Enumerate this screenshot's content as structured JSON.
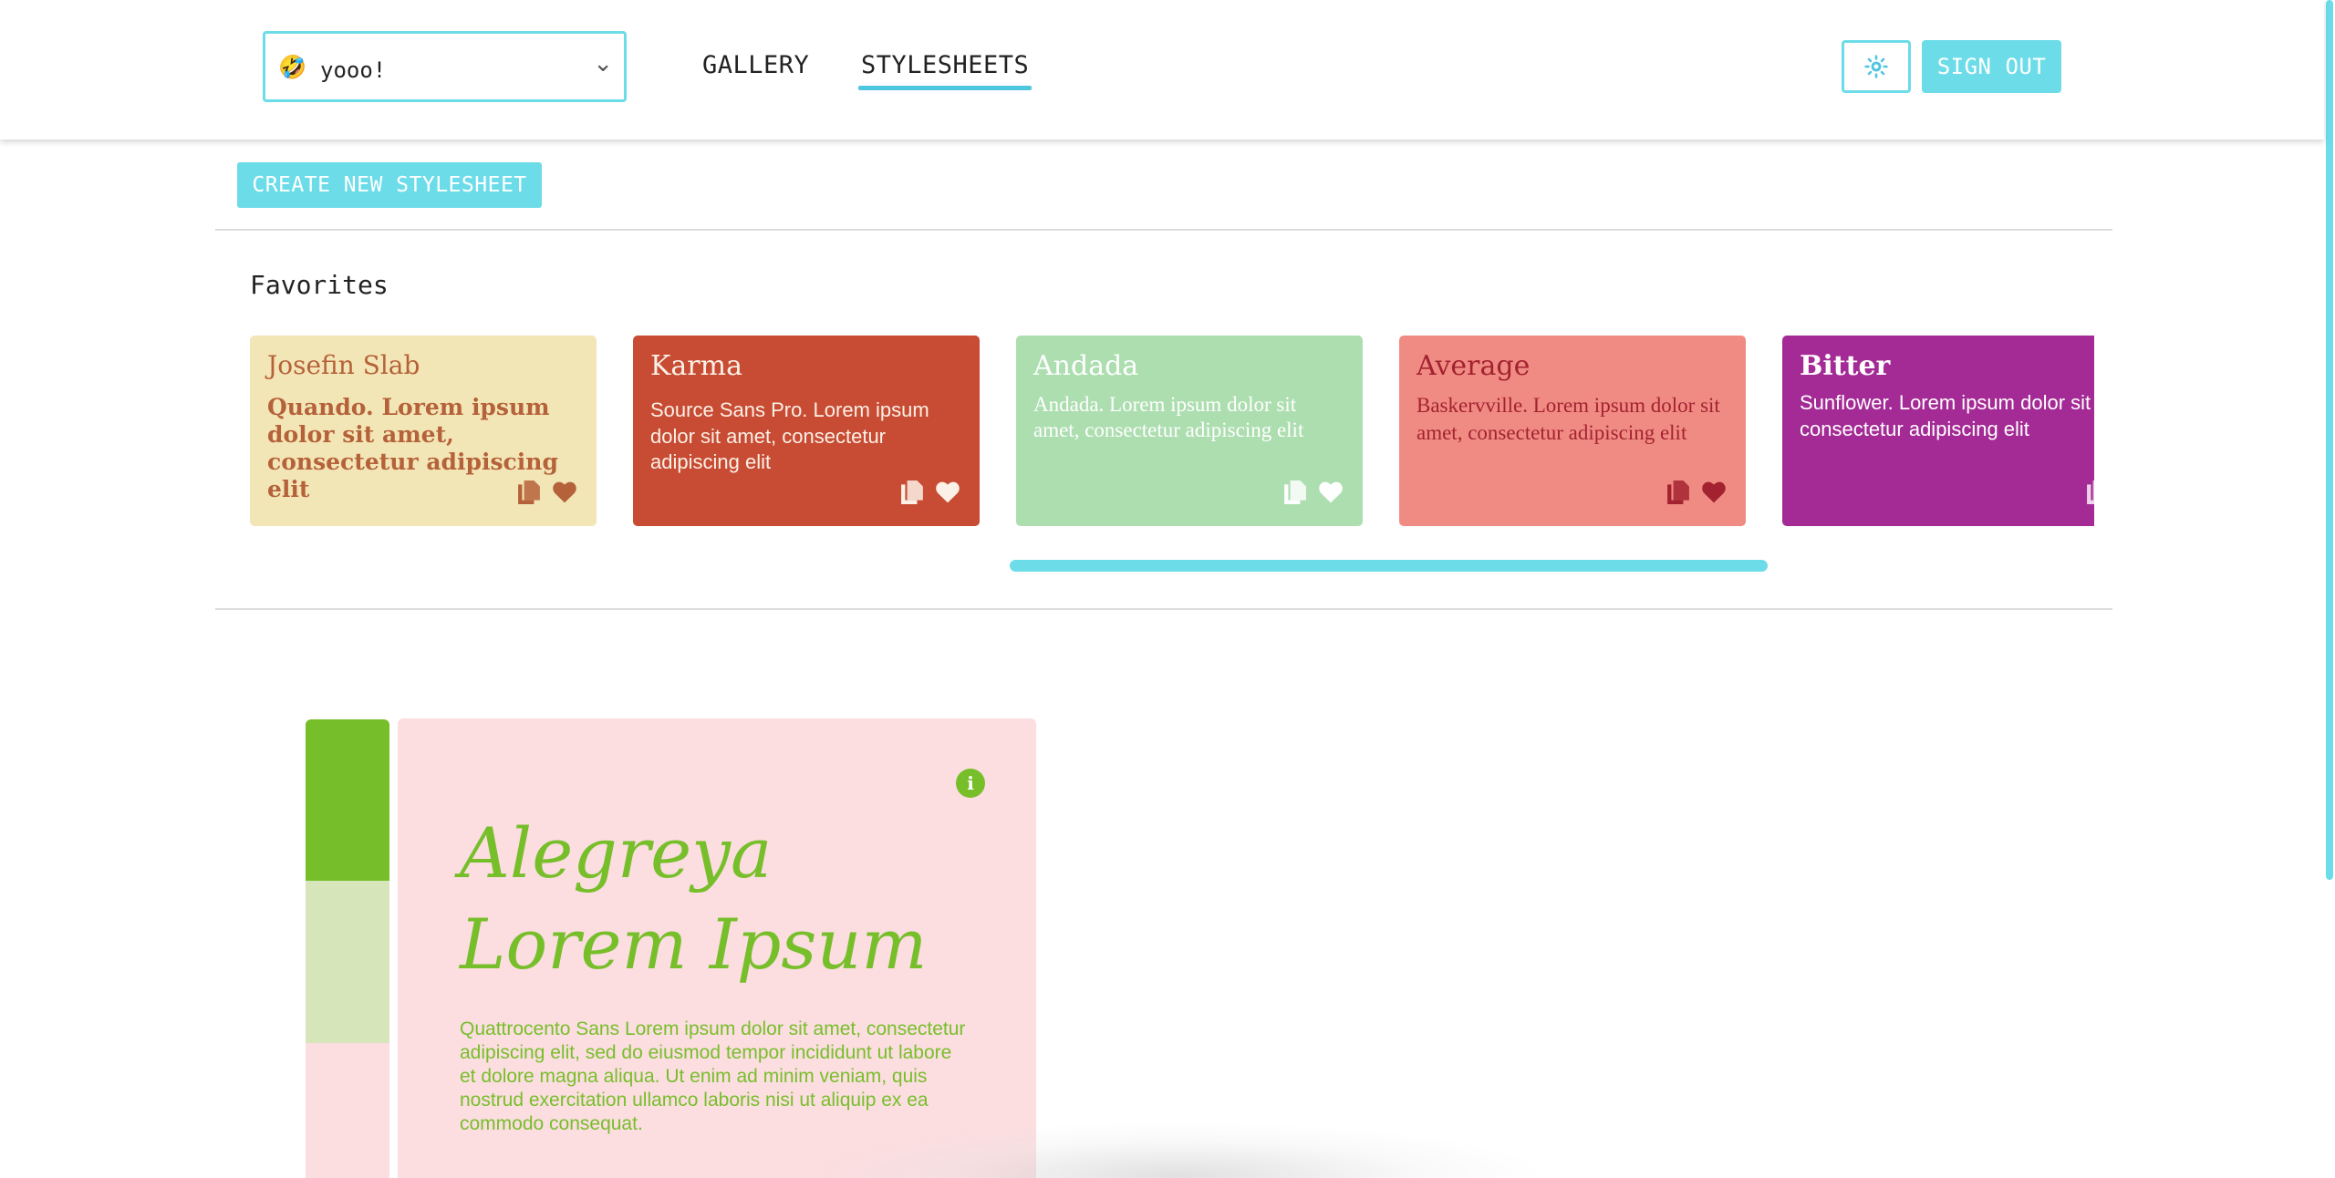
{
  "header": {
    "account": {
      "emoji": "🤣",
      "name": "yooo!"
    },
    "tabs": [
      {
        "label": "GALLERY",
        "active": false
      },
      {
        "label": "STYLESHEETS",
        "active": true
      }
    ],
    "theme_icon": "sun-icon",
    "sign_out_label": "SIGN OUT"
  },
  "actions": {
    "create_label": "CREATE NEW STYLESHEET"
  },
  "favorites": {
    "title": "Favorites",
    "cards": [
      {
        "title": "Josefin Slab",
        "body": "Quando. Lorem ipsum dolor sit amet, consectetur adipiscing elit",
        "favorited": true
      },
      {
        "title": "Karma",
        "body": "Source Sans Pro. Lorem ipsum dolor sit amet, consectetur adipiscing elit",
        "favorited": false
      },
      {
        "title": "Andada",
        "body": "Andada. Lorem ipsum dolor sit amet, consectetur adipiscing elit",
        "favorited": false
      },
      {
        "title": "Average",
        "body": "Baskervville. Lorem ipsum dolor sit amet, consectetur adipiscing elit",
        "favorited": true
      },
      {
        "title": "Bitter",
        "body": "Sunflower. Lorem ipsum dolor sit amet, consectetur adipiscing elit",
        "favorited": false
      }
    ]
  },
  "preview": {
    "palette": [
      "#77bf2a",
      "#d7e5bb",
      "#fcdde0"
    ],
    "title": "Alegreya Lorem Ipsum",
    "body": "Quattrocento Sans Lorem ipsum dolor sit amet, consectetur adipiscing elit, sed do eiusmod tempor incididunt ut labore et dolore magna aliqua. Ut enim ad minim veniam, quis nostrud exercitation ullamco laboris nisi ut aliquip ex ea commodo consequat."
  },
  "colors": {
    "accent": "#6ddce9",
    "tab_underline": "#4fc6e0",
    "preview_text": "#77bf2a"
  }
}
